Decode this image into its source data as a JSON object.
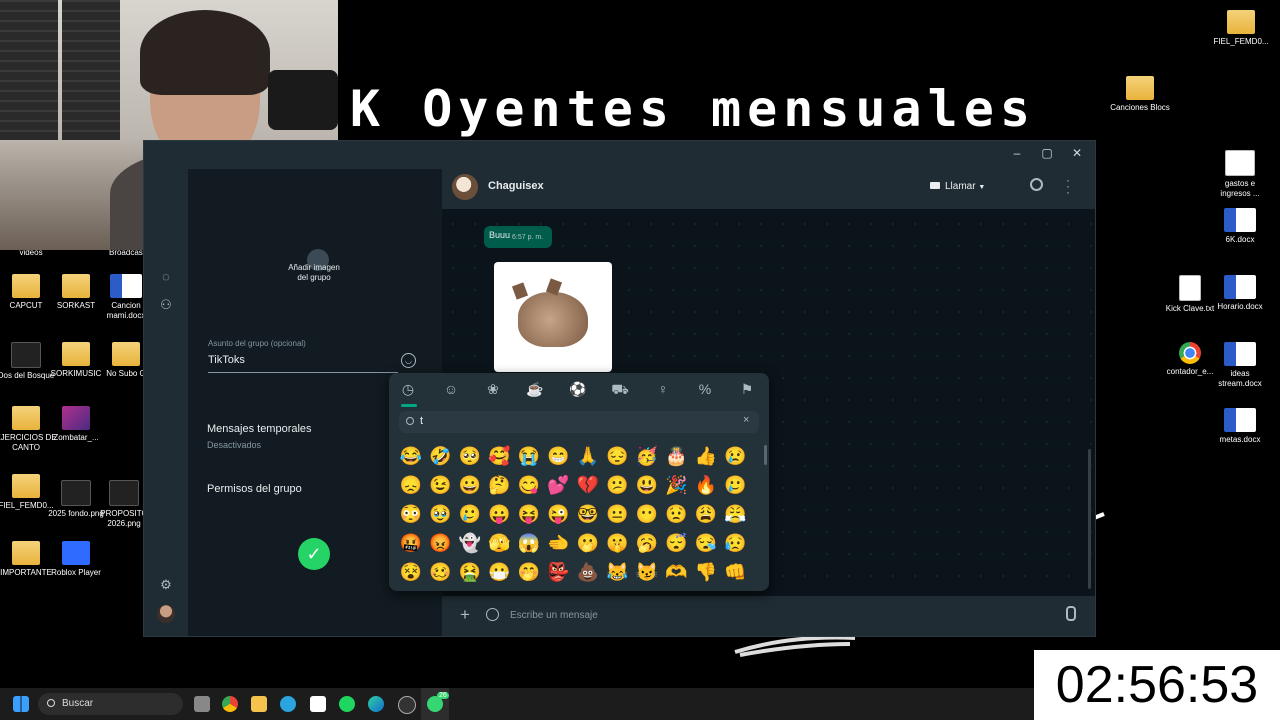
{
  "overlay": {
    "handwriting": "K Oyentes mensuales"
  },
  "timer": "02:56:53",
  "desktop_icons": [
    {
      "label": "videos",
      "type": "folder"
    },
    {
      "label": "Broadcast",
      "type": "folder"
    },
    {
      "label": "CAPCUT",
      "type": "folder"
    },
    {
      "label": "SORKAST",
      "type": "folder"
    },
    {
      "label": "Cancion mami.docx",
      "type": "word"
    },
    {
      "label": "Dos del Bosque",
      "type": "img"
    },
    {
      "label": "SORKIMUSIC",
      "type": "folder"
    },
    {
      "label": "No Subo G",
      "type": "folder"
    },
    {
      "label": "EJERCICIOS DE CANTO",
      "type": "folder"
    },
    {
      "label": "Zombatar_...",
      "type": "pink"
    },
    {
      "label": "FIEL_FEMD0...",
      "type": "folder"
    },
    {
      "label": "2025 fondo.png",
      "type": "img"
    },
    {
      "label": "PROPOSITO 2026.png",
      "type": "img"
    },
    {
      "label": "IMPORTANTE",
      "type": "folder"
    },
    {
      "label": "Roblox Player",
      "type": "roblox"
    },
    {
      "label": "FIEL_FEMD0...",
      "type": "folder"
    },
    {
      "label": "Canciones Blocs",
      "type": "folder"
    },
    {
      "label": "gastos e ingresos ...",
      "type": "txt"
    },
    {
      "label": "6K.docx",
      "type": "word"
    },
    {
      "label": "Kick Clave.txt",
      "type": "txt"
    },
    {
      "label": "Horario.docx",
      "type": "word"
    },
    {
      "label": "contador_e...",
      "type": "chrome"
    },
    {
      "label": "ideas stream.docx",
      "type": "word"
    },
    {
      "label": "metas.docx",
      "type": "word"
    }
  ],
  "whatsapp": {
    "window_controls": [
      "–",
      "▢",
      "✕"
    ],
    "group_form": {
      "add_image_label": "Añadir imagen del grupo",
      "subject_label": "Asunto del grupo (opcional)",
      "subject_value": "TikToks",
      "temp_messages_label": "Mensajes temporales",
      "temp_messages_value": "Desactivados",
      "permissions_label": "Permisos del grupo"
    },
    "chat": {
      "contact_name": "Chaguisex",
      "call_label": "Llamar",
      "message_text": "Buuu",
      "message_time": "6:57 p. m.",
      "composer_placeholder": "Escribe un mensaje"
    },
    "emoji_panel": {
      "search_value": "t",
      "tabs": [
        "recent-icon",
        "smiley-icon",
        "animals-icon",
        "food-icon",
        "activity-icon",
        "travel-icon",
        "objects-icon",
        "symbols-icon",
        "flags-icon"
      ],
      "emojis": [
        "😂",
        "🤣",
        "🥺",
        "🥰",
        "😭",
        "😁",
        "🙏",
        "😔",
        "🥳",
        "🎂",
        "👍",
        "😢",
        "😞",
        "😉",
        "😀",
        "🤔",
        "😋",
        "💕",
        "💔",
        "😕",
        "😃",
        "🎉",
        "🔥",
        "🥲",
        "😳",
        "🥹",
        "🥲",
        "😛",
        "😝",
        "😜",
        "🤓",
        "😐",
        "😶",
        "😟",
        "😩",
        "😤",
        "🤬",
        "😡",
        "👻",
        "🫣",
        "😱",
        "🫲",
        "🫢",
        "🤫",
        "🥱",
        "😴",
        "😪",
        "😥",
        "😵",
        "🥴",
        "🤮",
        "😷",
        "🤭",
        "👺",
        "💩",
        "😹",
        "😼",
        "🫶",
        "👎",
        "👊"
      ]
    }
  },
  "taskbar": {
    "search_placeholder": "Buscar",
    "whatsapp_badge": "26"
  }
}
